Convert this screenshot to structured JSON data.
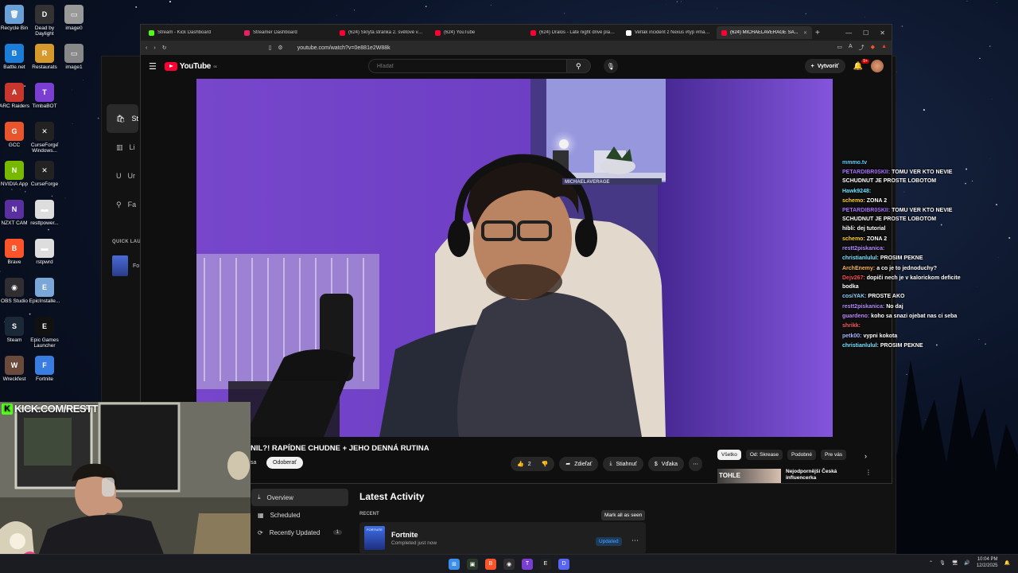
{
  "desktop": {
    "icons": [
      {
        "label": "Recycle Bin",
        "color": "#6aa0d8",
        "glyph": "🗑"
      },
      {
        "label": "Dead by Daylight",
        "color": "#333",
        "glyph": "D"
      },
      {
        "label": "image0",
        "color": "#999",
        "glyph": "▭"
      },
      {
        "label": "Battle.net",
        "color": "#1c7dd9",
        "glyph": "B"
      },
      {
        "label": "Restaurats",
        "color": "#d69a2c",
        "glyph": "R"
      },
      {
        "label": "image1",
        "color": "#888",
        "glyph": "▭"
      },
      {
        "label": "ARC Raiders",
        "color": "#c8372d",
        "glyph": "A"
      },
      {
        "label": "TimbaBOT",
        "color": "#7a3fd1",
        "glyph": "T"
      },
      {
        "label": "GCC",
        "color": "#e8542b",
        "glyph": "G"
      },
      {
        "label": "CurseForge Windows...",
        "color": "#222",
        "glyph": "✕"
      },
      {
        "label": "NVIDIA App",
        "color": "#76b900",
        "glyph": "N"
      },
      {
        "label": "CurseForge",
        "color": "#222",
        "glyph": "✕"
      },
      {
        "label": "NZXT CAM",
        "color": "#5a2fa0",
        "glyph": "N"
      },
      {
        "label": "resttpower...",
        "color": "#ddd",
        "glyph": "▬"
      },
      {
        "label": "Brave",
        "color": "#fb542b",
        "glyph": "B"
      },
      {
        "label": "rstpwrd",
        "color": "#ddd",
        "glyph": "▬"
      },
      {
        "label": "OBS Studio",
        "color": "#302e31",
        "glyph": "◉"
      },
      {
        "label": "EpicInstalle...",
        "color": "#7aa7d8",
        "glyph": "E"
      },
      {
        "label": "Steam",
        "color": "#1b2838",
        "glyph": "S"
      },
      {
        "label": "Epic Games Launcher",
        "color": "#111",
        "glyph": "E"
      },
      {
        "label": "Wreckfest",
        "color": "#6a4a3a",
        "glyph": "W"
      },
      {
        "label": "Fortnite",
        "color": "#3a7de0",
        "glyph": "F"
      }
    ]
  },
  "epic": {
    "nav": [
      {
        "icon": "🛍",
        "label": "St"
      },
      {
        "icon": "▥",
        "label": "Li"
      },
      {
        "icon": "U",
        "label": "Ur"
      },
      {
        "icon": "⚲",
        "label": "Fa"
      }
    ],
    "quick_launch_label": "QUICK LAU",
    "quick_item": "Fo",
    "library_links": [
      {
        "label": "Overview",
        "count": ""
      },
      {
        "label": "Scheduled",
        "count": ""
      },
      {
        "label": "Recently Updated",
        "count": "1"
      }
    ],
    "activity_title": "Latest Activity",
    "recent_label": "RECENT",
    "mark_all": "Mark all as seen",
    "game_name": "Fortnite",
    "game_status": "Completed just now",
    "updated_badge": "Updated",
    "thumb_text": "FORTNITE"
  },
  "browser": {
    "tabs": [
      {
        "label": "Stream - Kick Dashboard",
        "color": "#53fc18",
        "active": false
      },
      {
        "label": "Streamer Dashboard",
        "color": "#e91e63",
        "active": false
      },
      {
        "label": "(624) Skrytá stránka 2. světové války...",
        "color": "#ff0033",
        "active": false
      },
      {
        "label": "(624) YouTube",
        "color": "#ff0033",
        "active": false
      },
      {
        "label": "(624) Dralos - Late night drive playlist...",
        "color": "#ff0033",
        "active": false
      },
      {
        "label": "Veľlak incident z Nexus #typ #maximal...",
        "color": "#ffffff",
        "active": false
      },
      {
        "label": "(624) MICHAELAVERAGE SA...",
        "color": "#ff0033",
        "active": true
      }
    ],
    "url": "youtube.com/watch?v=0e881e2W88k",
    "youtube": {
      "logo_text": "YouTube",
      "region": "SK",
      "search_placeholder": "Hľadať",
      "create_label": "Vytvoriť",
      "notif_count": "9+",
      "video_title": "NIL?! RAPÍDNE CHUDNE + JEHO DENNÁ RUTINA",
      "channel_fragment": "sa",
      "subscribe_label": "Odoberať",
      "likes": "2",
      "share_label": "Zdieľať",
      "download_label": "Stiahnuť",
      "thanks_label": "Vďaka",
      "chips": [
        "Všetko",
        "Od: Skrease",
        "Podobné",
        "Pre vás"
      ],
      "rec_thumb_text": "TOHLE",
      "rec_title": "Nejodpornější Česká influencerka",
      "wall_sign": "MICHAELAVERAGE"
    }
  },
  "chat": [
    {
      "user": "mmmo.tv",
      "text": "",
      "color": "#5ad1ff"
    },
    {
      "user": "PETARDIBR0SKII:",
      "text": "TOMU VER KTO NEVIE SCHUDNUT JE PROSTE LOBOTOM",
      "color": "#a970ff"
    },
    {
      "user": "Hawk9248:",
      "text": "",
      "color": "#6ee0ff"
    },
    {
      "user": "schemo:",
      "text": "ZONA 2",
      "color": "#ffd23f"
    },
    {
      "user": "PETARDIBR0SKII:",
      "text": "TOMU VER KTO NEVIE SCHUDNUT JE PROSTE LOBOTOM",
      "color": "#a970ff"
    },
    {
      "user": "hibli:",
      "text": "dej tutorial",
      "color": "#ffffff"
    },
    {
      "user": "schemo:",
      "text": "ZONA 2",
      "color": "#ffd23f"
    },
    {
      "user": "restt2piskanica:",
      "text": "",
      "color": "#b48cff"
    },
    {
      "user": "christianlulul:",
      "text": "PROSIM PEKNE",
      "color": "#7fe3ff"
    },
    {
      "user": "ArchEnemy:",
      "text": "a co je to jednoduchy?",
      "color": "#ffb84d"
    },
    {
      "user": "Dejv267:",
      "text": "dopiči nech je v kalorickom deficite bodka",
      "color": "#ff4d4d"
    },
    {
      "user": "cosiYAK:",
      "text": "PROSTE AKO",
      "color": "#8fd3ff"
    },
    {
      "user": "restt2piskanica:",
      "text": "No daj",
      "color": "#b48cff"
    },
    {
      "user": "guardeno:",
      "text": "koho sa snazi ojebat nas ci seba",
      "color": "#c387ff"
    },
    {
      "user": "shrikk:",
      "text": "",
      "color": "#ff5d5d"
    },
    {
      "user": "petk00:",
      "text": "vypni kokota",
      "color": "#a9b7ff"
    },
    {
      "user": "christianlulul:",
      "text": "PROSIM PEKNE",
      "color": "#7fe3ff"
    }
  ],
  "overlay": {
    "kick_text": "KICK.COM/RESTT"
  },
  "taskbar": {
    "time": "10:04 PM",
    "date": "12/2/2025",
    "apps": [
      {
        "glyph": "⊞",
        "color": "#3b8eea"
      },
      {
        "glyph": "▣",
        "color": "#2a3a2a"
      },
      {
        "glyph": "B",
        "color": "#fb542b"
      },
      {
        "glyph": "◉",
        "color": "#302e31"
      },
      {
        "glyph": "T",
        "color": "#7a3fd1"
      },
      {
        "glyph": "E",
        "color": "#222"
      },
      {
        "glyph": "D",
        "color": "#5865f2"
      }
    ]
  }
}
